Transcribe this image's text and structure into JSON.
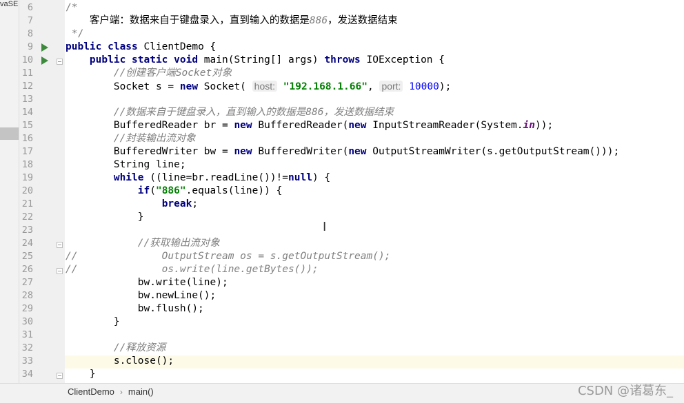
{
  "left_panel": {
    "tab_label": "vaSE"
  },
  "editor": {
    "line_numbers": [
      "6",
      "7",
      "8",
      "9",
      "10",
      "11",
      "12",
      "13",
      "14",
      "15",
      "16",
      "17",
      "18",
      "19",
      "20",
      "21",
      "22",
      "23",
      "24",
      "25",
      "26",
      "27",
      "28",
      "29",
      "30",
      "31",
      "32",
      "33",
      "34"
    ],
    "code_lines": [
      [
        {
          "t": "/*",
          "c": "cmt-plain"
        }
      ],
      [
        {
          "t": "    客户端：数据来自于键盘录入，直到输入的数据是",
          "c": ""
        },
        {
          "t": "886",
          "c": "cmt"
        },
        {
          "t": "，发送数据结束",
          "c": ""
        }
      ],
      [
        {
          "t": " */",
          "c": "cmt-plain"
        }
      ],
      [
        {
          "t": "public class",
          "c": "kw"
        },
        {
          "t": " ClientDemo {",
          "c": ""
        }
      ],
      [
        {
          "t": "    ",
          "c": ""
        },
        {
          "t": "public static void",
          "c": "kw"
        },
        {
          "t": " main(String[] args) ",
          "c": ""
        },
        {
          "t": "throws",
          "c": "kw"
        },
        {
          "t": " IOException {",
          "c": ""
        }
      ],
      [
        {
          "t": "        //创建客户端",
          "c": "cmt"
        },
        {
          "t": "Socket",
          "c": "cmt"
        },
        {
          "t": "对象",
          "c": "cmt"
        }
      ],
      [
        {
          "t": "        Socket s = ",
          "c": ""
        },
        {
          "t": "new",
          "c": "kw"
        },
        {
          "t": " Socket( ",
          "c": ""
        },
        {
          "t": "host:",
          "c": "hint"
        },
        {
          "t": " ",
          "c": ""
        },
        {
          "t": "\"192.168.1.66\"",
          "c": "str"
        },
        {
          "t": ", ",
          "c": ""
        },
        {
          "t": "port:",
          "c": "hint"
        },
        {
          "t": " ",
          "c": ""
        },
        {
          "t": "10000",
          "c": "num"
        },
        {
          "t": ");",
          "c": ""
        }
      ],
      [],
      [
        {
          "t": "        //数据来自于键盘录入，直到输入的数据是",
          "c": "cmt"
        },
        {
          "t": "886",
          "c": "cmt"
        },
        {
          "t": "，发送数据结束",
          "c": "cmt"
        }
      ],
      [
        {
          "t": "        BufferedReader br = ",
          "c": ""
        },
        {
          "t": "new",
          "c": "kw"
        },
        {
          "t": " BufferedReader(",
          "c": ""
        },
        {
          "t": "new",
          "c": "kw"
        },
        {
          "t": " InputStreamReader(System.",
          "c": ""
        },
        {
          "t": "in",
          "c": "static"
        },
        {
          "t": "));",
          "c": ""
        }
      ],
      [
        {
          "t": "        //封装输出流对象",
          "c": "cmt"
        }
      ],
      [
        {
          "t": "        BufferedWriter bw = ",
          "c": ""
        },
        {
          "t": "new",
          "c": "kw"
        },
        {
          "t": " BufferedWriter(",
          "c": ""
        },
        {
          "t": "new",
          "c": "kw"
        },
        {
          "t": " OutputStreamWriter(s.getOutputStream()));",
          "c": ""
        }
      ],
      [
        {
          "t": "        String line;",
          "c": ""
        }
      ],
      [
        {
          "t": "        ",
          "c": ""
        },
        {
          "t": "while",
          "c": "kw"
        },
        {
          "t": " ((line=br.readLine())!=",
          "c": ""
        },
        {
          "t": "null",
          "c": "kw"
        },
        {
          "t": ") {",
          "c": ""
        }
      ],
      [
        {
          "t": "            ",
          "c": ""
        },
        {
          "t": "if",
          "c": "kw"
        },
        {
          "t": "(",
          "c": ""
        },
        {
          "t": "\"886\"",
          "c": "str"
        },
        {
          "t": ".equals(line)) {",
          "c": ""
        }
      ],
      [
        {
          "t": "                ",
          "c": ""
        },
        {
          "t": "break",
          "c": "kw"
        },
        {
          "t": ";",
          "c": ""
        }
      ],
      [
        {
          "t": "            }",
          "c": ""
        }
      ],
      [],
      [
        {
          "t": "            //获取输出流对象",
          "c": "cmt"
        }
      ],
      [
        {
          "t": "//              OutputStream os = s.getOutputStream();",
          "c": "cmt"
        }
      ],
      [
        {
          "t": "//              os.write(line.getBytes());",
          "c": "cmt"
        }
      ],
      [
        {
          "t": "            bw.write(line);",
          "c": ""
        }
      ],
      [
        {
          "t": "            bw.newLine();",
          "c": ""
        }
      ],
      [
        {
          "t": "            bw.flush();",
          "c": ""
        }
      ],
      [
        {
          "t": "        }",
          "c": ""
        }
      ],
      [],
      [
        {
          "t": "        //释放资源",
          "c": "cmt"
        }
      ],
      [
        {
          "t": "        s.close();",
          "c": ""
        }
      ],
      [
        {
          "t": "    }",
          "c": ""
        }
      ]
    ]
  },
  "breadcrumb": {
    "class": "ClientDemo",
    "method": "main()"
  },
  "watermark": "CSDN @诸葛东_"
}
